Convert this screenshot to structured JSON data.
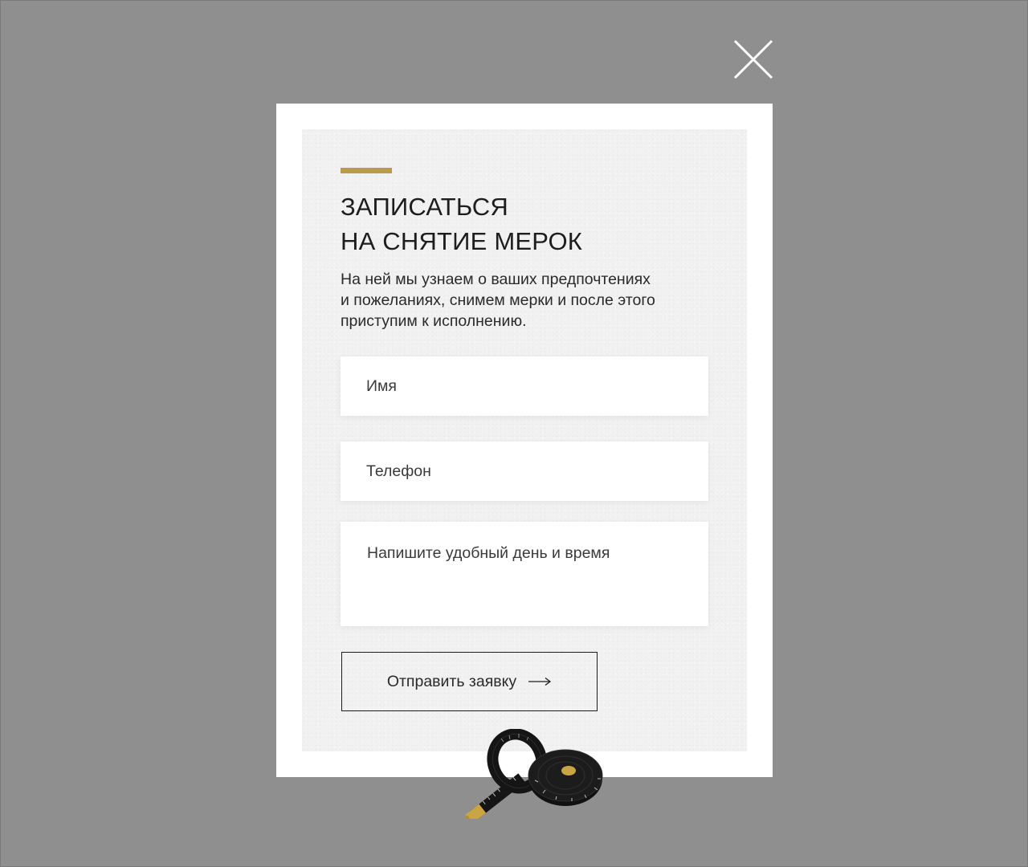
{
  "modal": {
    "title_line1": "ЗАПИСАТЬСЯ",
    "title_line2": "НА СНЯТИЕ МЕРОК",
    "description_lines": [
      "На ней мы узнаем о ваших предпочтениях",
      "и пожеланиях, снимем мерки и после этого",
      "приступим к исполнению."
    ]
  },
  "form": {
    "name_placeholder": "Имя",
    "phone_placeholder": "Телефон",
    "time_placeholder": "Напишите удобный день и время",
    "submit_label": "Отправить заявку"
  },
  "icons": {
    "close": "close-icon",
    "arrow": "arrow-right-icon",
    "decoration": "measuring-tape-icon"
  },
  "colors": {
    "overlay": "#8f8f8f",
    "accent": "#b89b4e",
    "text": "#1d1d1d"
  }
}
